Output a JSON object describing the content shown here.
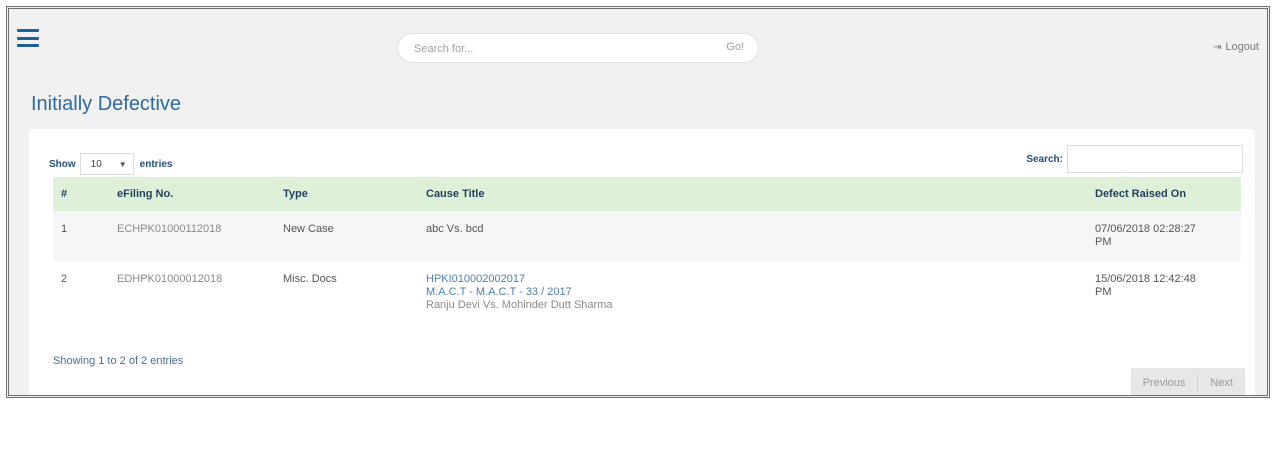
{
  "header": {
    "search_placeholder": "Search for...",
    "go_label": "Go!",
    "logout_label": "Logout"
  },
  "page": {
    "title": "Initially Defective"
  },
  "table_controls": {
    "show_label": "Show",
    "page_size": "10",
    "entries_label": "entries",
    "search_label": "Search:"
  },
  "table": {
    "columns": [
      "#",
      "eFiling No.",
      "Type",
      "Cause Title",
      "Defect Raised On"
    ],
    "rows": [
      {
        "num": "1",
        "efiling_no": "ECHPK01000112018",
        "type": "New Case",
        "cause_line1": "abc Vs. bcd",
        "cause_line2": "",
        "cause_line3": "",
        "raised_on_line1": "07/06/2018 02:28:27",
        "raised_on_line2": "PM"
      },
      {
        "num": "2",
        "efiling_no": "EDHPK01000012018",
        "type": "Misc. Docs",
        "cause_line1": "HPKI010002002017",
        "cause_line2": "M.A.C.T - M.A.C.T - 33 / 2017",
        "cause_line3": "Ranju Devi Vs. Mohinder Dutt Sharma",
        "raised_on_line1": "15/06/2018 12:42:48",
        "raised_on_line2": "PM"
      }
    ]
  },
  "footer": {
    "info_text": "Showing 1 to 2 of 2 entries",
    "previous_label": "Previous",
    "next_label": "Next"
  },
  "colors": {
    "accent": "#2d6aa3",
    "header_row": "#dff0d8"
  }
}
